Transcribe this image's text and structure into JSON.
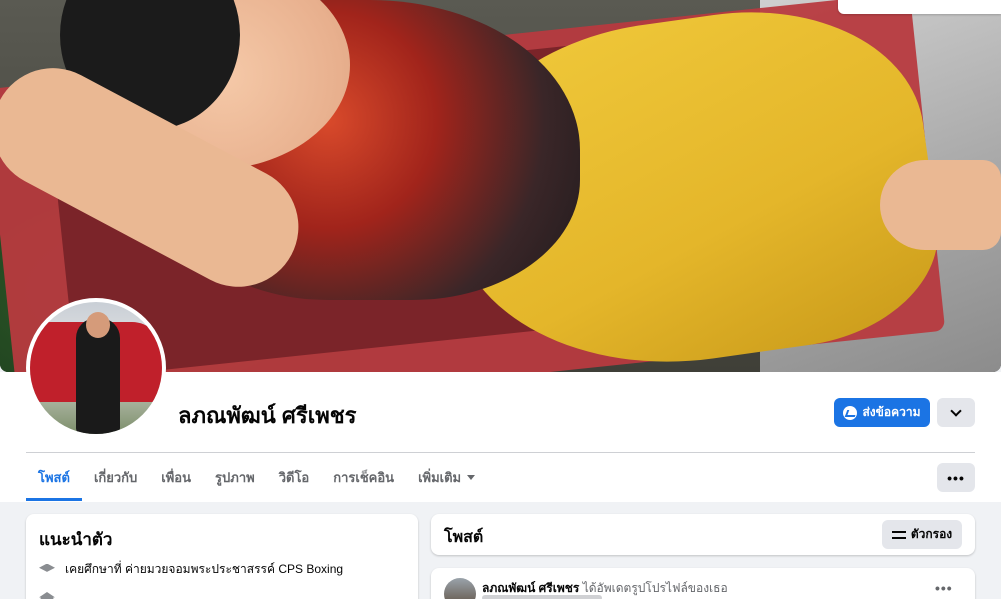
{
  "profile": {
    "name": "ลภณพัฒน์ ศรีเพชร",
    "message_button": "ส่งข้อความ"
  },
  "tabs": [
    {
      "label": "โพสต์",
      "active": true
    },
    {
      "label": "เกี่ยวกับ"
    },
    {
      "label": "เพื่อน"
    },
    {
      "label": "รูปภาพ"
    },
    {
      "label": "วิดีโอ"
    },
    {
      "label": "การเช็คอิน"
    },
    {
      "label": "เพิ่มเติม"
    }
  ],
  "more_button": "•••",
  "intro": {
    "title": "แนะนำตัว",
    "rows": [
      {
        "icon": "graduation-cap-icon",
        "prefix": "เคยศึกษาที่",
        "value": "ค่ายมวยจอมพระประชาสรรค์ CPS Boxing"
      }
    ]
  },
  "posts": {
    "title": "โพสต์",
    "filter_label": "ตัวกรอง"
  },
  "post": {
    "author": "ลภณพัฒน์ ศรีเพชร",
    "action": "ได้อัพเดตรูปโปรไฟล์ของเธอ",
    "more": "•••"
  },
  "colors": {
    "accent": "#1b74e4",
    "page_bg": "#f0f2f5",
    "button_gray": "#e4e6eb"
  }
}
